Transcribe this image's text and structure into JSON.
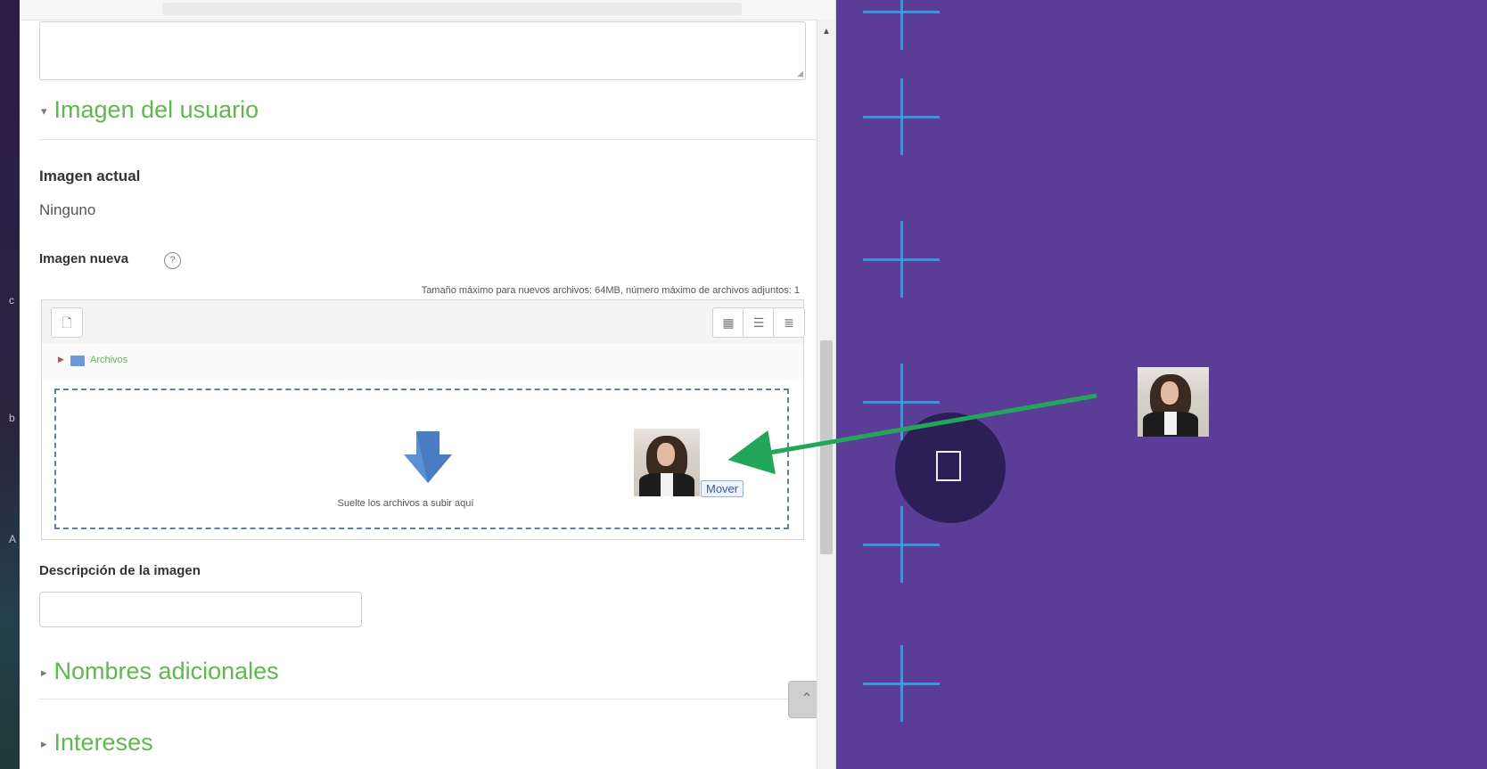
{
  "sections": {
    "user_image": {
      "caret": "▾",
      "title": "Imagen del usuario"
    },
    "additional_names": {
      "caret": "▸",
      "title": "Nombres adicionales"
    },
    "interests": {
      "caret": "▸",
      "title": "Intereses"
    }
  },
  "current_image": {
    "label": "Imagen actual",
    "value": "Ninguno"
  },
  "new_image": {
    "label": "Imagen nueva",
    "help_icon_glyph": "?",
    "limits_hint": "Tamaño máximo para nuevos archivos: 64MB, número máximo de archivos adjuntos: 1"
  },
  "file_picker": {
    "path_label": "Archivos",
    "drop_text": "Suelte los archivos a subir aquí",
    "drag_tooltip": "Mover",
    "buttons": {
      "add_file_glyph": "🗋",
      "icon_view_glyph": "▦",
      "list_view_glyph": "☰",
      "tree_view_glyph": "≣"
    }
  },
  "image_description": {
    "label": "Descripción de la imagen",
    "value": ""
  },
  "back_to_top_glyph": "⌃",
  "colors": {
    "section_green": "#5eb84d",
    "drop_border": "#5b7fae",
    "overlay_purple": "#5b3d97",
    "crosshair_blue": "#33a8e8",
    "arrow_green": "#22a659"
  }
}
